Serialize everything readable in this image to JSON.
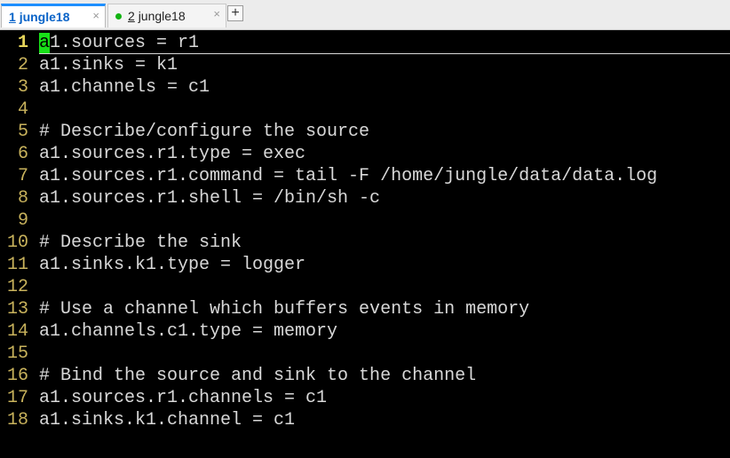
{
  "tabs": [
    {
      "number": "1",
      "title": "jungle18",
      "active": true,
      "close": "×"
    },
    {
      "number": "2",
      "title": "jungle18",
      "active": false,
      "close": "×"
    }
  ],
  "add_tab_label": "+",
  "colors": {
    "active_tab_accent": "#1e8fff",
    "status_dot": "#12b312",
    "line_number": "#c8b25c",
    "cursor": "#18e018",
    "text": "#d8d8d8",
    "background": "#000000"
  },
  "editor": {
    "cursor_line": 1,
    "lines": [
      {
        "num": "1",
        "text": "a1.sources = r1"
      },
      {
        "num": "2",
        "text": "a1.sinks = k1"
      },
      {
        "num": "3",
        "text": "a1.channels = c1"
      },
      {
        "num": "4",
        "text": ""
      },
      {
        "num": "5",
        "text": "# Describe/configure the source"
      },
      {
        "num": "6",
        "text": "a1.sources.r1.type = exec"
      },
      {
        "num": "7",
        "text": "a1.sources.r1.command = tail -F /home/jungle/data/data.log"
      },
      {
        "num": "8",
        "text": "a1.sources.r1.shell = /bin/sh -c"
      },
      {
        "num": "9",
        "text": ""
      },
      {
        "num": "10",
        "text": "# Describe the sink"
      },
      {
        "num": "11",
        "text": "a1.sinks.k1.type = logger"
      },
      {
        "num": "12",
        "text": ""
      },
      {
        "num": "13",
        "text": "# Use a channel which buffers events in memory"
      },
      {
        "num": "14",
        "text": "a1.channels.c1.type = memory"
      },
      {
        "num": "15",
        "text": ""
      },
      {
        "num": "16",
        "text": "# Bind the source and sink to the channel"
      },
      {
        "num": "17",
        "text": "a1.sources.r1.channels = c1"
      },
      {
        "num": "18",
        "text": "a1.sinks.k1.channel = c1"
      }
    ]
  }
}
